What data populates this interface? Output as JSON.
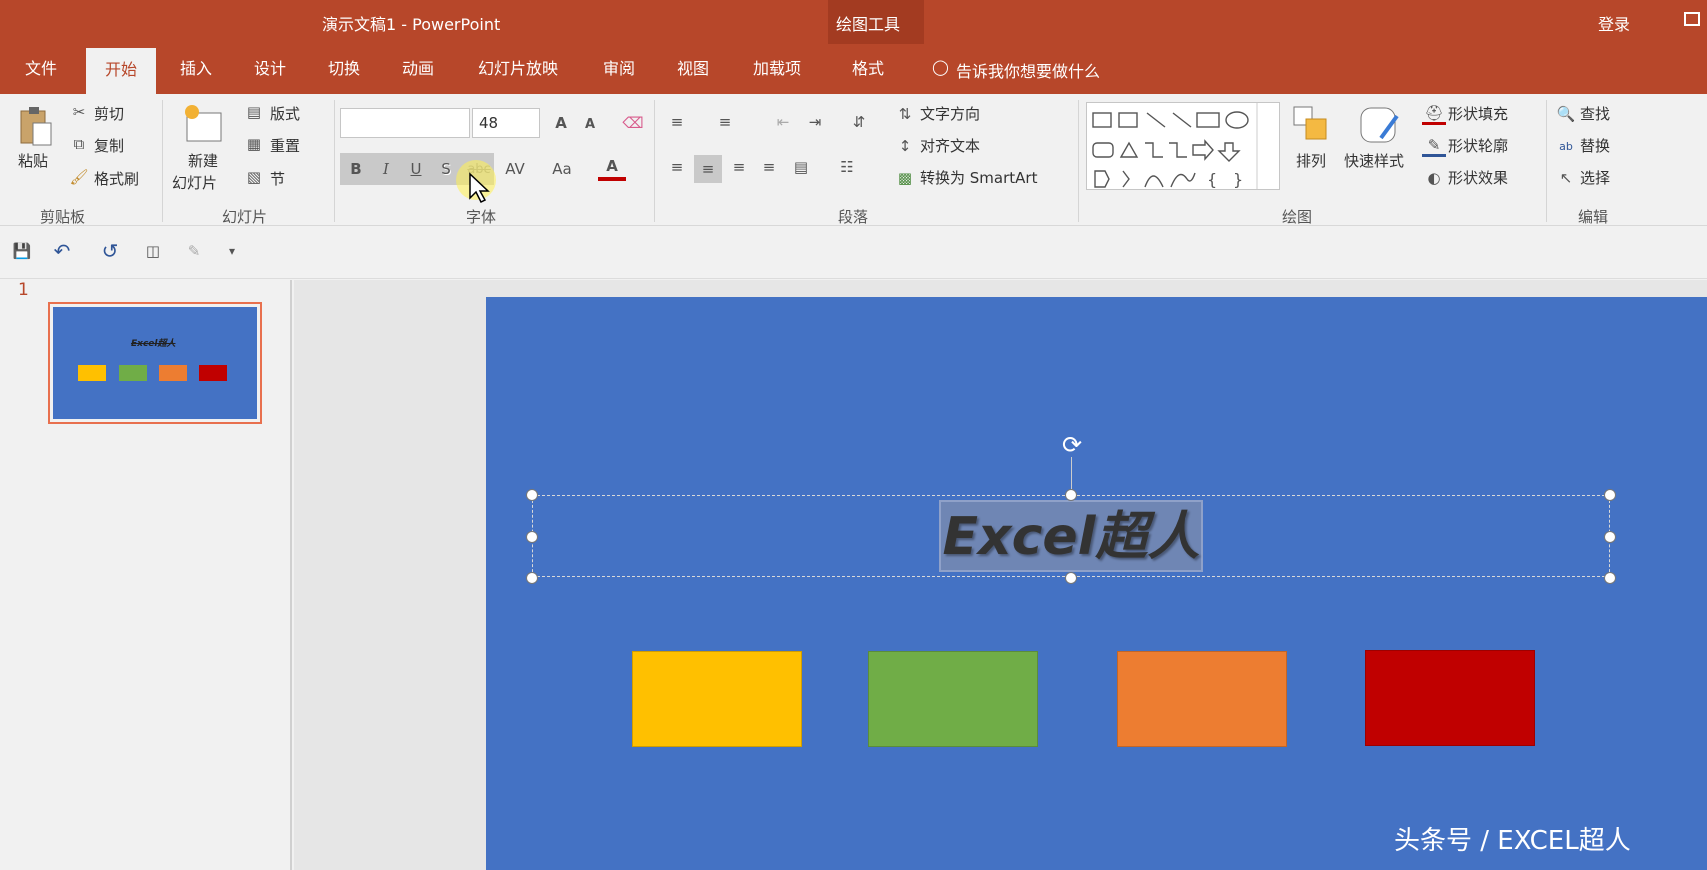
{
  "titlebar": {
    "doc_title": "演示文稿1  -  PowerPoint",
    "context_tools": "绘图工具",
    "signin": "登录"
  },
  "tabs": [
    {
      "label": "文件"
    },
    {
      "label": "开始"
    },
    {
      "label": "插入"
    },
    {
      "label": "设计"
    },
    {
      "label": "切换"
    },
    {
      "label": "动画"
    },
    {
      "label": "幻灯片放映"
    },
    {
      "label": "审阅"
    },
    {
      "label": "视图"
    },
    {
      "label": "加载项"
    },
    {
      "label": "格式"
    }
  ],
  "tellme": "告诉我你想要做什么",
  "ribbon": {
    "clipboard": {
      "paste": "粘贴",
      "cut": "剪切",
      "copy": "复制",
      "format_painter": "格式刷",
      "group": "剪贴板"
    },
    "slides": {
      "new_slide_1": "新建",
      "new_slide_2": "幻灯片",
      "layout": "版式",
      "reset": "重置",
      "section": "节",
      "group": "幻灯片"
    },
    "font": {
      "font_name": "",
      "font_size": "48",
      "bold": "B",
      "italic": "I",
      "underline": "U",
      "shadow": "S",
      "strike": "abc",
      "spacing": "AV",
      "case": "Aa",
      "color": "A",
      "group": "字体"
    },
    "paragraph": {
      "text_direction": "文字方向",
      "align_text": "对齐文本",
      "smartart": "转换为 SmartArt",
      "group": "段落"
    },
    "drawing": {
      "arrange": "排列",
      "quick_styles": "快速样式",
      "fill": "形状填充",
      "outline": "形状轮廓",
      "effects": "形状效果",
      "group": "绘图"
    },
    "editing": {
      "find": "查找",
      "replace": "替换",
      "select": "选择",
      "group": "编辑"
    }
  },
  "thumbnail": {
    "number": "1",
    "title": "Excel超人"
  },
  "slide": {
    "title": "Excel超人"
  },
  "colors": {
    "accent": "#b7472a",
    "slide_bg": "#4472c4",
    "yellow": "#ffc000",
    "green": "#70ad47",
    "orange": "#ed7d31",
    "red": "#c00000"
  },
  "watermark": "头条号 / EXCEL超人"
}
